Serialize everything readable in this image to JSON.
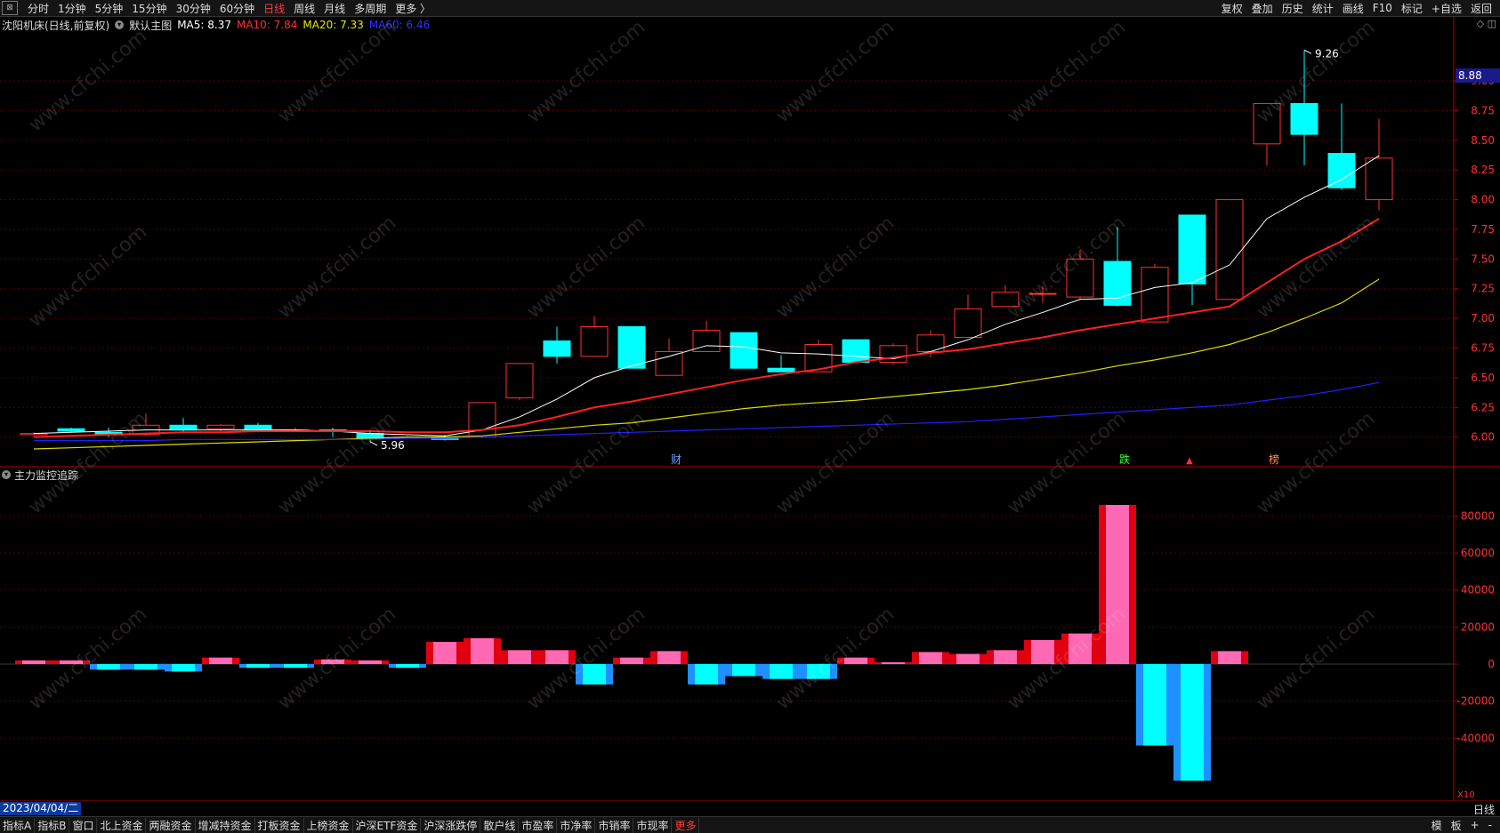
{
  "topbar": {
    "periods": [
      "分时",
      "1分钟",
      "5分钟",
      "15分钟",
      "30分钟",
      "60分钟",
      "日线",
      "周线",
      "月线",
      "多周期",
      "更多 〉"
    ],
    "active_period": "日线",
    "right_tools": [
      "复权",
      "叠加",
      "历史",
      "统计",
      "画线",
      "F10",
      "标记",
      "+自选",
      "返回"
    ]
  },
  "info": {
    "stock": "沈阳机床(日线,前复权)",
    "template": "默认主图",
    "ma5": "MA5: 8.37",
    "ma10": "MA10: 7.84",
    "ma20": "MA20: 7.33",
    "ma60": "MA60: 6.46",
    "indicator_title": "主力监控追踪"
  },
  "price_box": "8.88",
  "date_label": "2023/04/04/二",
  "cycle_label": "日线",
  "bottombar": {
    "tabs": [
      "指标A",
      "指标B",
      "窗口",
      "北上资金",
      "两融资金",
      "增减持资金",
      "打板资金",
      "上榜资金",
      "沪深ETF资金",
      "沪深涨跌停",
      "散户线",
      "市盈率",
      "市净率",
      "市销率",
      "市现率",
      "更多"
    ],
    "active_tab": "更多",
    "right": [
      "模",
      "板",
      "+",
      "-"
    ]
  },
  "annotations": {
    "high": "9.26",
    "low": "5.96",
    "events": [
      "财",
      "跌",
      "榜"
    ]
  },
  "watermark": "www.cfchi.com",
  "colors": {
    "up": "#ff3030",
    "down": "#00ffff",
    "ma5": "#ffffff",
    "ma10": "#ff2020",
    "ma20": "#dddd00",
    "ma60": "#2020ff",
    "pink": "#ff69b4",
    "blue": "#1e90ff"
  },
  "chart_data": [
    {
      "type": "candlestick",
      "y_ticks": [
        "9.00",
        "8.75",
        "8.50",
        "8.25",
        "8.00",
        "7.75",
        "7.50",
        "7.25",
        "7.00",
        "6.75",
        "6.50",
        "6.25",
        "6.00"
      ],
      "ylim": [
        5.9,
        9.3
      ],
      "candles": [
        {
          "o": 6.02,
          "c": 6.03,
          "h": 6.04,
          "l": 6.01
        },
        {
          "o": 6.07,
          "c": 6.05,
          "h": 6.08,
          "l": 6.04
        },
        {
          "o": 6.04,
          "c": 6.02,
          "h": 6.08,
          "l": 6.0
        },
        {
          "o": 6.02,
          "c": 6.1,
          "h": 6.2,
          "l": 6.01
        },
        {
          "o": 6.1,
          "c": 6.06,
          "h": 6.16,
          "l": 6.04
        },
        {
          "o": 6.07,
          "c": 6.1,
          "h": 6.11,
          "l": 6.05
        },
        {
          "o": 6.1,
          "c": 6.06,
          "h": 6.12,
          "l": 6.04
        },
        {
          "o": 6.06,
          "c": 6.06,
          "h": 6.08,
          "l": 6.04
        },
        {
          "o": 6.06,
          "c": 6.05,
          "h": 6.08,
          "l": 6.0
        },
        {
          "o": 6.03,
          "c": 5.99,
          "h": 6.04,
          "l": 5.96
        },
        {
          "o": 6.0,
          "c": 6.0,
          "h": 6.01,
          "l": 5.99
        },
        {
          "o": 6.0,
          "c": 5.98,
          "h": 6.02,
          "l": 5.97
        },
        {
          "o": 6.0,
          "c": 6.29,
          "h": 6.29,
          "l": 5.99
        },
        {
          "o": 6.33,
          "c": 6.62,
          "h": 6.62,
          "l": 6.31
        },
        {
          "o": 6.81,
          "c": 6.68,
          "h": 6.93,
          "l": 6.62
        },
        {
          "o": 6.68,
          "c": 6.93,
          "h": 7.02,
          "l": 6.68
        },
        {
          "o": 6.93,
          "c": 6.58,
          "h": 6.93,
          "l": 6.58
        },
        {
          "o": 6.52,
          "c": 6.72,
          "h": 6.83,
          "l": 6.52
        },
        {
          "o": 6.72,
          "c": 6.9,
          "h": 6.98,
          "l": 6.72
        },
        {
          "o": 6.88,
          "c": 6.58,
          "h": 6.88,
          "l": 6.58
        },
        {
          "o": 6.58,
          "c": 6.55,
          "h": 6.69,
          "l": 6.55
        },
        {
          "o": 6.55,
          "c": 6.78,
          "h": 6.82,
          "l": 6.55
        },
        {
          "o": 6.82,
          "c": 6.63,
          "h": 6.82,
          "l": 6.63
        },
        {
          "o": 6.63,
          "c": 6.77,
          "h": 6.79,
          "l": 6.61
        },
        {
          "o": 6.72,
          "c": 6.86,
          "h": 6.9,
          "l": 6.67
        },
        {
          "o": 6.84,
          "c": 7.08,
          "h": 7.2,
          "l": 6.84
        },
        {
          "o": 7.1,
          "c": 7.22,
          "h": 7.28,
          "l": 7.1
        },
        {
          "o": 7.21,
          "c": 7.21,
          "h": 7.27,
          "l": 7.13
        },
        {
          "o": 7.18,
          "c": 7.5,
          "h": 7.58,
          "l": 7.16
        },
        {
          "o": 7.48,
          "c": 7.11,
          "h": 7.77,
          "l": 7.1
        },
        {
          "o": 6.97,
          "c": 7.43,
          "h": 7.46,
          "l": 6.97
        },
        {
          "o": 7.87,
          "c": 7.29,
          "h": 7.87,
          "l": 7.11
        },
        {
          "o": 7.16,
          "c": 8.0,
          "h": 8.0,
          "l": 7.16
        },
        {
          "o": 8.47,
          "c": 8.81,
          "h": 8.81,
          "l": 8.29
        },
        {
          "o": 8.81,
          "c": 8.55,
          "h": 9.26,
          "l": 8.29
        },
        {
          "o": 8.39,
          "c": 8.1,
          "h": 8.81,
          "l": 8.08
        },
        {
          "o": 8.0,
          "c": 8.35,
          "h": 8.68,
          "l": 7.91
        }
      ],
      "ma5": [
        6.03,
        6.04,
        6.05,
        6.06,
        6.06,
        6.06,
        6.06,
        6.06,
        6.05,
        6.03,
        6.02,
        6.01,
        6.06,
        6.17,
        6.32,
        6.5,
        6.6,
        6.68,
        6.77,
        6.76,
        6.71,
        6.7,
        6.68,
        6.66,
        6.72,
        6.82,
        6.95,
        7.05,
        7.16,
        7.17,
        7.26,
        7.3,
        7.45,
        7.84,
        8.02,
        8.17,
        8.37
      ],
      "ma10": [
        6.0,
        6.01,
        6.02,
        6.03,
        6.04,
        6.04,
        6.05,
        6.05,
        6.05,
        6.05,
        6.04,
        6.04,
        6.06,
        6.1,
        6.17,
        6.25,
        6.3,
        6.36,
        6.42,
        6.48,
        6.53,
        6.57,
        6.63,
        6.67,
        6.71,
        6.74,
        6.79,
        6.84,
        6.9,
        6.95,
        7.0,
        7.05,
        7.1,
        7.3,
        7.5,
        7.65,
        7.84
      ],
      "ma20": [
        5.9,
        5.91,
        5.92,
        5.93,
        5.94,
        5.95,
        5.96,
        5.97,
        5.98,
        5.99,
        6.0,
        6.0,
        6.01,
        6.04,
        6.07,
        6.1,
        6.12,
        6.16,
        6.2,
        6.24,
        6.27,
        6.29,
        6.31,
        6.34,
        6.37,
        6.4,
        6.44,
        6.49,
        6.54,
        6.6,
        6.65,
        6.71,
        6.78,
        6.88,
        7.0,
        7.13,
        7.33
      ],
      "ma60": [
        5.97,
        5.97,
        5.97,
        5.97,
        5.98,
        5.98,
        5.98,
        5.98,
        5.98,
        5.98,
        5.99,
        5.99,
        6.0,
        6.01,
        6.02,
        6.03,
        6.04,
        6.05,
        6.06,
        6.07,
        6.08,
        6.09,
        6.1,
        6.11,
        6.12,
        6.13,
        6.15,
        6.17,
        6.19,
        6.21,
        6.23,
        6.25,
        6.27,
        6.31,
        6.35,
        6.4,
        6.46
      ]
    },
    {
      "type": "bar",
      "title": "主力监控追踪",
      "y_ticks": [
        "80000",
        "60000",
        "40000",
        "20000",
        "0",
        "-20000",
        "-40000"
      ],
      "ylim": [
        -63000,
        86000
      ],
      "values": [
        2000,
        2000,
        -3000,
        -3000,
        -4000,
        3500,
        -2000,
        -2000,
        2500,
        2000,
        -2000,
        12000,
        14000,
        7500,
        7500,
        -11000,
        3500,
        7000,
        -11000,
        -6500,
        -8000,
        -8000,
        3500,
        1000,
        6500,
        5500,
        7500,
        13000,
        16500,
        86000,
        -44000,
        -63000,
        7000
      ],
      "overlay_values": [
        2000,
        2000,
        -3000,
        -3000,
        -4000,
        3500,
        -2000,
        -2000,
        2500,
        2000,
        -2000,
        12000,
        14000,
        7500,
        7500,
        -11000,
        3500,
        7000,
        -11000,
        -6500,
        -8000,
        -8000,
        3500,
        1000,
        6500,
        5500,
        7500,
        13000,
        16500,
        86000,
        -44000,
        -63000,
        7000
      ]
    }
  ]
}
